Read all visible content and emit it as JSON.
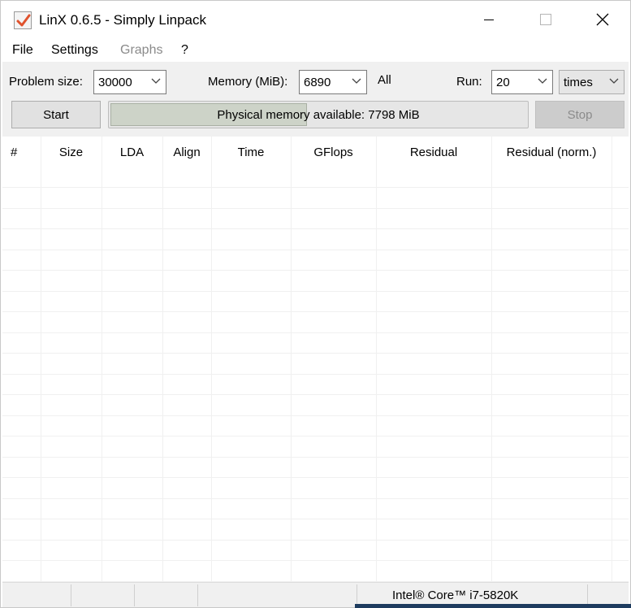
{
  "window": {
    "title": "LinX 0.6.5 - Simply Linpack"
  },
  "menu": {
    "items": [
      {
        "label": "File",
        "enabled": true
      },
      {
        "label": "Settings",
        "enabled": true
      },
      {
        "label": "Graphs",
        "enabled": false
      },
      {
        "label": "?",
        "enabled": true
      }
    ]
  },
  "controls": {
    "problem_size_label": "Problem size:",
    "problem_size_value": "30000",
    "memory_label": "Memory (MiB):",
    "memory_value": "6890",
    "all_label": "All",
    "run_label": "Run:",
    "run_value": "20",
    "run_unit": "times",
    "start_label": "Start",
    "stop_label": "Stop",
    "progress_text": "Physical memory available: 7798 MiB",
    "progress_fraction": 0.47
  },
  "table": {
    "columns": [
      "#",
      "Size",
      "LDA",
      "Align",
      "Time",
      "GFlops",
      "Residual",
      "Residual (norm.)"
    ],
    "rows": []
  },
  "status": {
    "cpu": "Intel® Core™ i7-5820K"
  },
  "colors": {
    "accent": "#1e3c5f",
    "panel": "#f0f0f0",
    "check": "#e0522d"
  }
}
